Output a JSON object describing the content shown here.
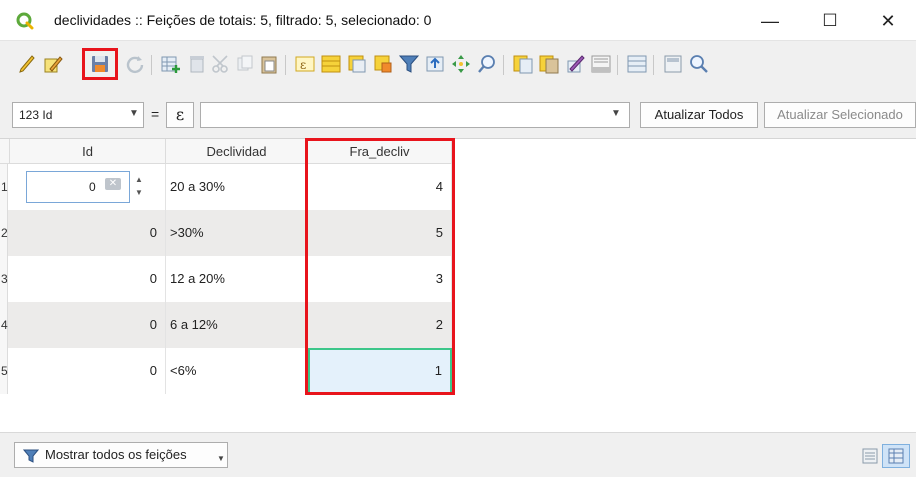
{
  "window": {
    "title": "declividades :: Feições de totais: 5, filtrado: 5, selecionado: 0",
    "minimize_glyph": "—",
    "maximize_glyph": "☐",
    "close_glyph": "✕"
  },
  "toolbar": {
    "icons": [
      "edit-pencil-icon",
      "multi-edit-icon",
      "save-edits-icon",
      "reload-icon",
      "add-feature-icon",
      "delete-feature-icon",
      "cut-icon",
      "copy-icon",
      "paste-icon",
      "expression-select-icon",
      "select-all-icon",
      "invert-selection-icon",
      "deselect-icon",
      "filter-icon",
      "move-top-icon",
      "pan-icon",
      "zoom-icon",
      "copy-row-icon",
      "paste-row-icon",
      "field-calculator-icon",
      "conditional-format-icon",
      "organize-columns-icon",
      "dock-icon",
      "actions-icon"
    ],
    "highlight_color": "#e8141c"
  },
  "expression_bar": {
    "field_select": "123 Id",
    "equals": "=",
    "epsilon": "ε",
    "expression_value": "",
    "update_all_label": "Atualizar Todos",
    "update_selected_label": "Atualizar Selecionado"
  },
  "table": {
    "columns": [
      "Id",
      "Declividad",
      "Fra_decliv"
    ],
    "rows": [
      {
        "num": "1",
        "id": "0",
        "declividad": "20 a 30%",
        "fra_decliv": "4"
      },
      {
        "num": "2",
        "id": "0",
        "declividad": ">30%",
        "fra_decliv": "5"
      },
      {
        "num": "3",
        "id": "0",
        "declividad": "12 a 20%",
        "fra_decliv": "3"
      },
      {
        "num": "4",
        "id": "0",
        "declividad": "6 a 12%",
        "fra_decliv": "2"
      },
      {
        "num": "5",
        "id": "0",
        "declividad": "<6%",
        "fra_decliv": "1"
      }
    ],
    "active_cell_border": "#3cc68a",
    "column_highlight": "#e8141c"
  },
  "bottom_bar": {
    "filter_label": "Mostrar todos os feições"
  }
}
